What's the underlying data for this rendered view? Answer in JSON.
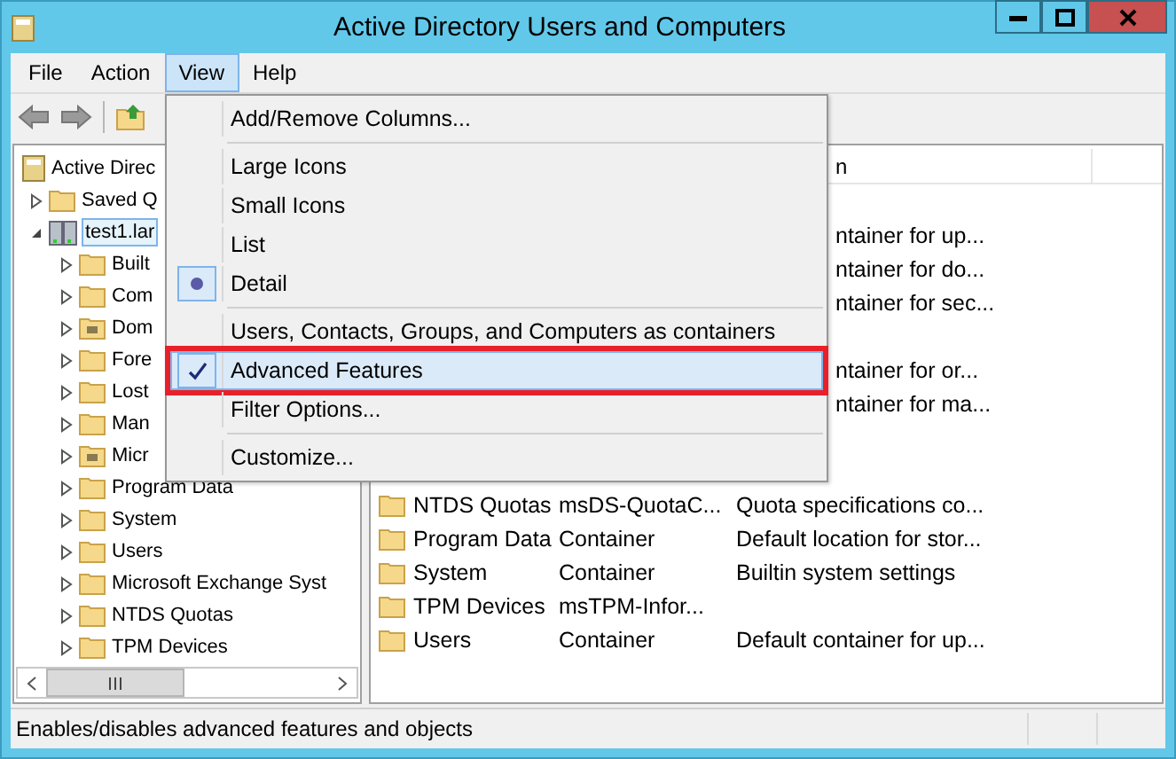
{
  "window": {
    "title": "Active Directory Users and Computers"
  },
  "menu_bar": [
    {
      "label": "File",
      "selected": false
    },
    {
      "label": "Action",
      "selected": false
    },
    {
      "label": "View",
      "selected": true
    },
    {
      "label": "Help",
      "selected": false
    }
  ],
  "view_menu": [
    {
      "kind": "command",
      "label": "Add/Remove Columns...",
      "highlighted": false,
      "outlined": false
    },
    {
      "kind": "separator"
    },
    {
      "kind": "radio",
      "label": "Large Icons",
      "checked": false,
      "highlighted": false,
      "outlined": false
    },
    {
      "kind": "radio",
      "label": "Small Icons",
      "checked": false,
      "highlighted": false,
      "outlined": false
    },
    {
      "kind": "radio",
      "label": "List",
      "checked": false,
      "highlighted": false,
      "outlined": false
    },
    {
      "kind": "radio",
      "label": "Detail",
      "checked": true,
      "highlighted": false,
      "outlined": false
    },
    {
      "kind": "separator"
    },
    {
      "kind": "check",
      "label": "Users, Contacts, Groups, and Computers as containers",
      "checked": false,
      "highlighted": false,
      "outlined": false
    },
    {
      "kind": "check",
      "label": "Advanced Features",
      "checked": true,
      "highlighted": true,
      "outlined": true
    },
    {
      "kind": "command",
      "label": "Filter Options...",
      "highlighted": false,
      "outlined": false
    },
    {
      "kind": "separator"
    },
    {
      "kind": "command",
      "label": "Customize...",
      "highlighted": false,
      "outlined": false
    }
  ],
  "tree": {
    "label": "Active Direc",
    "kind": "console",
    "children": [
      {
        "label": "Saved Q",
        "kind": "folder",
        "expanded": false,
        "selected": false
      },
      {
        "label": "test1.lar",
        "kind": "domain",
        "expanded": true,
        "selected": true,
        "children": [
          {
            "label": "Built",
            "kind": "folder",
            "expanded": false,
            "selected": false
          },
          {
            "label": "Com",
            "kind": "folder",
            "expanded": false,
            "selected": false
          },
          {
            "label": "Dom",
            "kind": "special",
            "expanded": false,
            "selected": false
          },
          {
            "label": "Fore",
            "kind": "folder",
            "expanded": false,
            "selected": false
          },
          {
            "label": "Lost",
            "kind": "folder",
            "expanded": false,
            "selected": false
          },
          {
            "label": "Man",
            "kind": "folder",
            "expanded": false,
            "selected": false
          },
          {
            "label": "Micr",
            "kind": "special",
            "expanded": false,
            "selected": false
          },
          {
            "label": "Program Data",
            "kind": "folder",
            "expanded": false,
            "selected": false
          },
          {
            "label": "System",
            "kind": "folder",
            "expanded": false,
            "selected": false
          },
          {
            "label": "Users",
            "kind": "folder",
            "expanded": false,
            "selected": false
          },
          {
            "label": "Microsoft Exchange Syst",
            "kind": "folder",
            "expanded": false,
            "selected": false
          },
          {
            "label": "NTDS Quotas",
            "kind": "folder",
            "expanded": false,
            "selected": false
          },
          {
            "label": "TPM Devices",
            "kind": "folder",
            "expanded": false,
            "selected": false
          }
        ]
      }
    ]
  },
  "list": {
    "columns": [
      {
        "label": "n"
      }
    ],
    "rows": [
      {
        "kind": "covered"
      },
      {
        "kind": "covered",
        "description": "ntainer for up..."
      },
      {
        "kind": "covered",
        "description": "ntainer for do..."
      },
      {
        "kind": "covered",
        "description": "ntainer for sec..."
      },
      {
        "kind": "covered"
      },
      {
        "kind": "covered",
        "description": "ntainer for or..."
      },
      {
        "kind": "covered",
        "description": "ntainer for ma..."
      },
      {
        "kind": "covered"
      },
      {
        "kind": "covered"
      },
      {
        "kind": "full",
        "name": "NTDS Quotas",
        "type": "msDS-QuotaC...",
        "description": "Quota specifications co..."
      },
      {
        "kind": "full",
        "name": "Program Data",
        "type": "Container",
        "description": "Default location for stor..."
      },
      {
        "kind": "full",
        "name": "System",
        "type": "Container",
        "description": "Builtin system settings"
      },
      {
        "kind": "full",
        "name": "TPM Devices",
        "type": "msTPM-Infor..."
      },
      {
        "kind": "full",
        "name": "Users",
        "type": "Container",
        "description": "Default container for up..."
      }
    ]
  },
  "status_bar": {
    "text": "Enables/disables advanced features and objects"
  }
}
